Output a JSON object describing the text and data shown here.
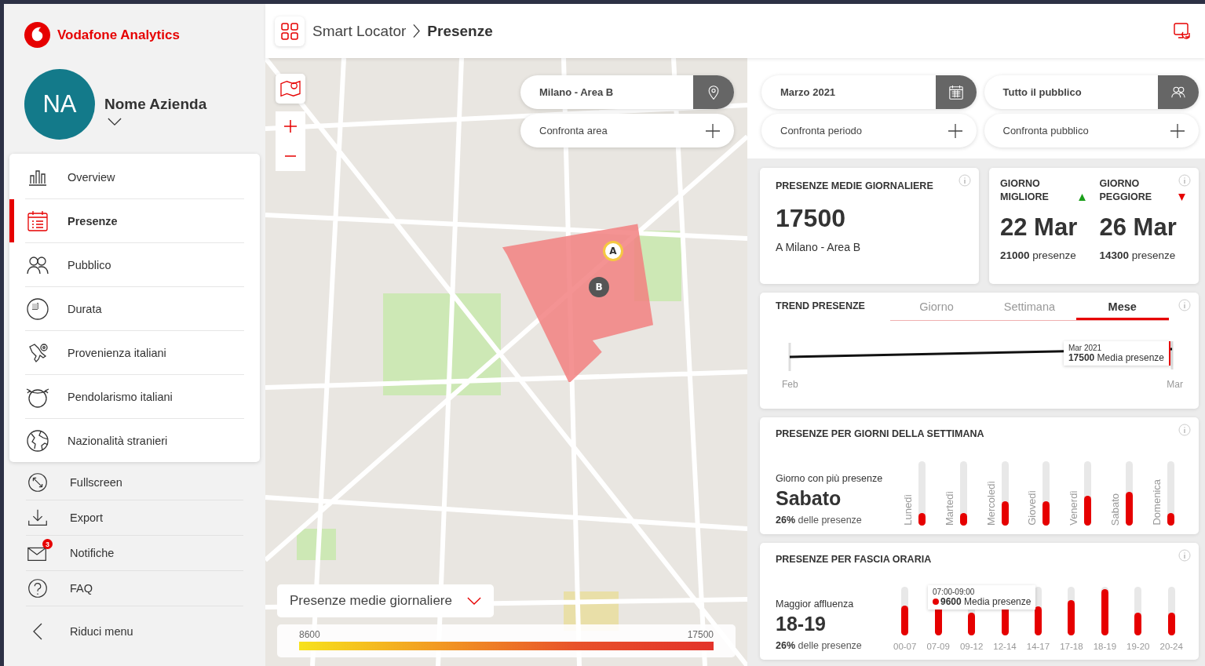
{
  "app": {
    "brand": "Vodafone Analytics"
  },
  "account": {
    "initials": "NA",
    "name": "Nome Azienda"
  },
  "nav": [
    {
      "label": "Overview",
      "kind": "chart",
      "selected": false
    },
    {
      "label": "Presenze",
      "kind": "calendar",
      "selected": true
    },
    {
      "label": "Pubblico",
      "kind": "people",
      "selected": false
    },
    {
      "label": "Durata",
      "kind": "clock",
      "selected": false
    },
    {
      "label": "Provenienza italiani",
      "kind": "italy",
      "selected": false
    },
    {
      "label": "Pendolarismo italiani",
      "kind": "commute",
      "selected": false
    },
    {
      "label": "Nazionalità stranieri",
      "kind": "globe",
      "selected": false
    }
  ],
  "utility_menu": [
    {
      "label": "Fullscreen",
      "kind": "fullscreen"
    },
    {
      "label": "Export",
      "kind": "export"
    },
    {
      "label": "Notifiche",
      "kind": "mail",
      "badge": "3"
    },
    {
      "label": "FAQ",
      "kind": "faq"
    },
    {
      "label": "Riduci menu",
      "kind": "back"
    }
  ],
  "breadcrumb": {
    "parent": "Smart Locator",
    "current": "Presenze"
  },
  "map": {
    "area": "Milano - Area B",
    "compare_area": "Confronta area",
    "markers": [
      "A",
      "B"
    ],
    "metric": "Presenze medie giornaliere",
    "legend_min": "8600",
    "legend_max": "17500"
  },
  "filters": {
    "period": "Marzo 2021",
    "compare_period": "Confronta periodo",
    "audience": "Tutto il pubblico",
    "compare_audience": "Confronta pubblico"
  },
  "daily_average": {
    "title": "PRESENZE MEDIE GIORNALIERE",
    "value": "17500",
    "place": "A Milano - Area B"
  },
  "best_worst": [
    {
      "title": "GIORNO MIGLIORE",
      "kind": "up",
      "date": "22 Mar",
      "count": "21000",
      "unit": "presenze"
    },
    {
      "title": "GIORNO PEGGIORE",
      "kind": "down",
      "date": "26 Mar",
      "count": "14300",
      "unit": "presenze"
    }
  ],
  "trend": {
    "title": "TREND PRESENZE",
    "tabs": [
      {
        "label": "Giorno",
        "selected": false
      },
      {
        "label": "Settimana",
        "selected": false
      },
      {
        "label": "Mese",
        "selected": true
      }
    ],
    "x_start": "Feb",
    "x_end": "Mar",
    "tooltip_title": "Mar 2021",
    "tooltip_value": "17500",
    "tooltip_label": "Media presenze"
  },
  "weekdays": {
    "title": "PRESENZE PER GIORNI DELLA SETTIMANA",
    "caption": "Giorno con più presenze",
    "top": "Sabato",
    "share": "26%",
    "share_label": "delle presenze",
    "bars": [
      {
        "label": "Lunedì",
        "level": 0.2
      },
      {
        "label": "Martedì",
        "level": 0.2
      },
      {
        "label": "Mercoledì",
        "level": 0.38
      },
      {
        "label": "Giovedì",
        "level": 0.38
      },
      {
        "label": "Venerdì",
        "level": 0.46
      },
      {
        "label": "Sabato",
        "level": 0.53
      },
      {
        "label": "Domenica",
        "level": 0.2
      }
    ]
  },
  "hours": {
    "title": "PRESENZE PER FASCIA ORARIA",
    "caption": "Maggior affluenza",
    "top": "18-19",
    "share": "26%",
    "share_label": "delle presenze",
    "tooltip_title": "07:00-09:00",
    "tooltip_value": "9600",
    "tooltip_label": "Media presenze",
    "bars": [
      {
        "label": "00-07",
        "level": 0.64
      },
      {
        "label": "07-09",
        "level": 0.84
      },
      {
        "label": "09-12",
        "level": 0.5
      },
      {
        "label": "12-14",
        "level": 0.84
      },
      {
        "label": "14-17",
        "level": 0.62
      },
      {
        "label": "17-18",
        "level": 0.76
      },
      {
        "label": "18-19",
        "level": 1.0
      },
      {
        "label": "19-20",
        "level": 0.5
      },
      {
        "label": "20-24",
        "level": 0.5
      }
    ]
  }
}
